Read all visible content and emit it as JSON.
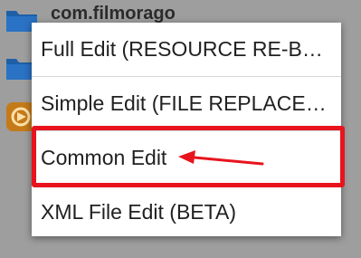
{
  "background": {
    "rows": [
      {
        "label": "com.filmorago",
        "icon": "folder-icon"
      },
      {
        "label": "",
        "icon": "folder-icon"
      },
      {
        "label": "",
        "icon": "app-icon"
      }
    ]
  },
  "menu": {
    "items": [
      {
        "label": "Full Edit (RESOURCE RE-BUILD)"
      },
      {
        "label": "Simple Edit (FILE REPLACEMENT)"
      },
      {
        "label": "Common Edit"
      },
      {
        "label": "XML File Edit (BETA)"
      }
    ]
  },
  "annotation": {
    "highlight_color": "#e8141d",
    "arrow_icon": "red-arrow-icon"
  },
  "colors": {
    "menu_bg": "#ffffff",
    "overlay": "#9e9e9e",
    "folder": "#1f5fa8",
    "app_icon": "#c47a18"
  }
}
